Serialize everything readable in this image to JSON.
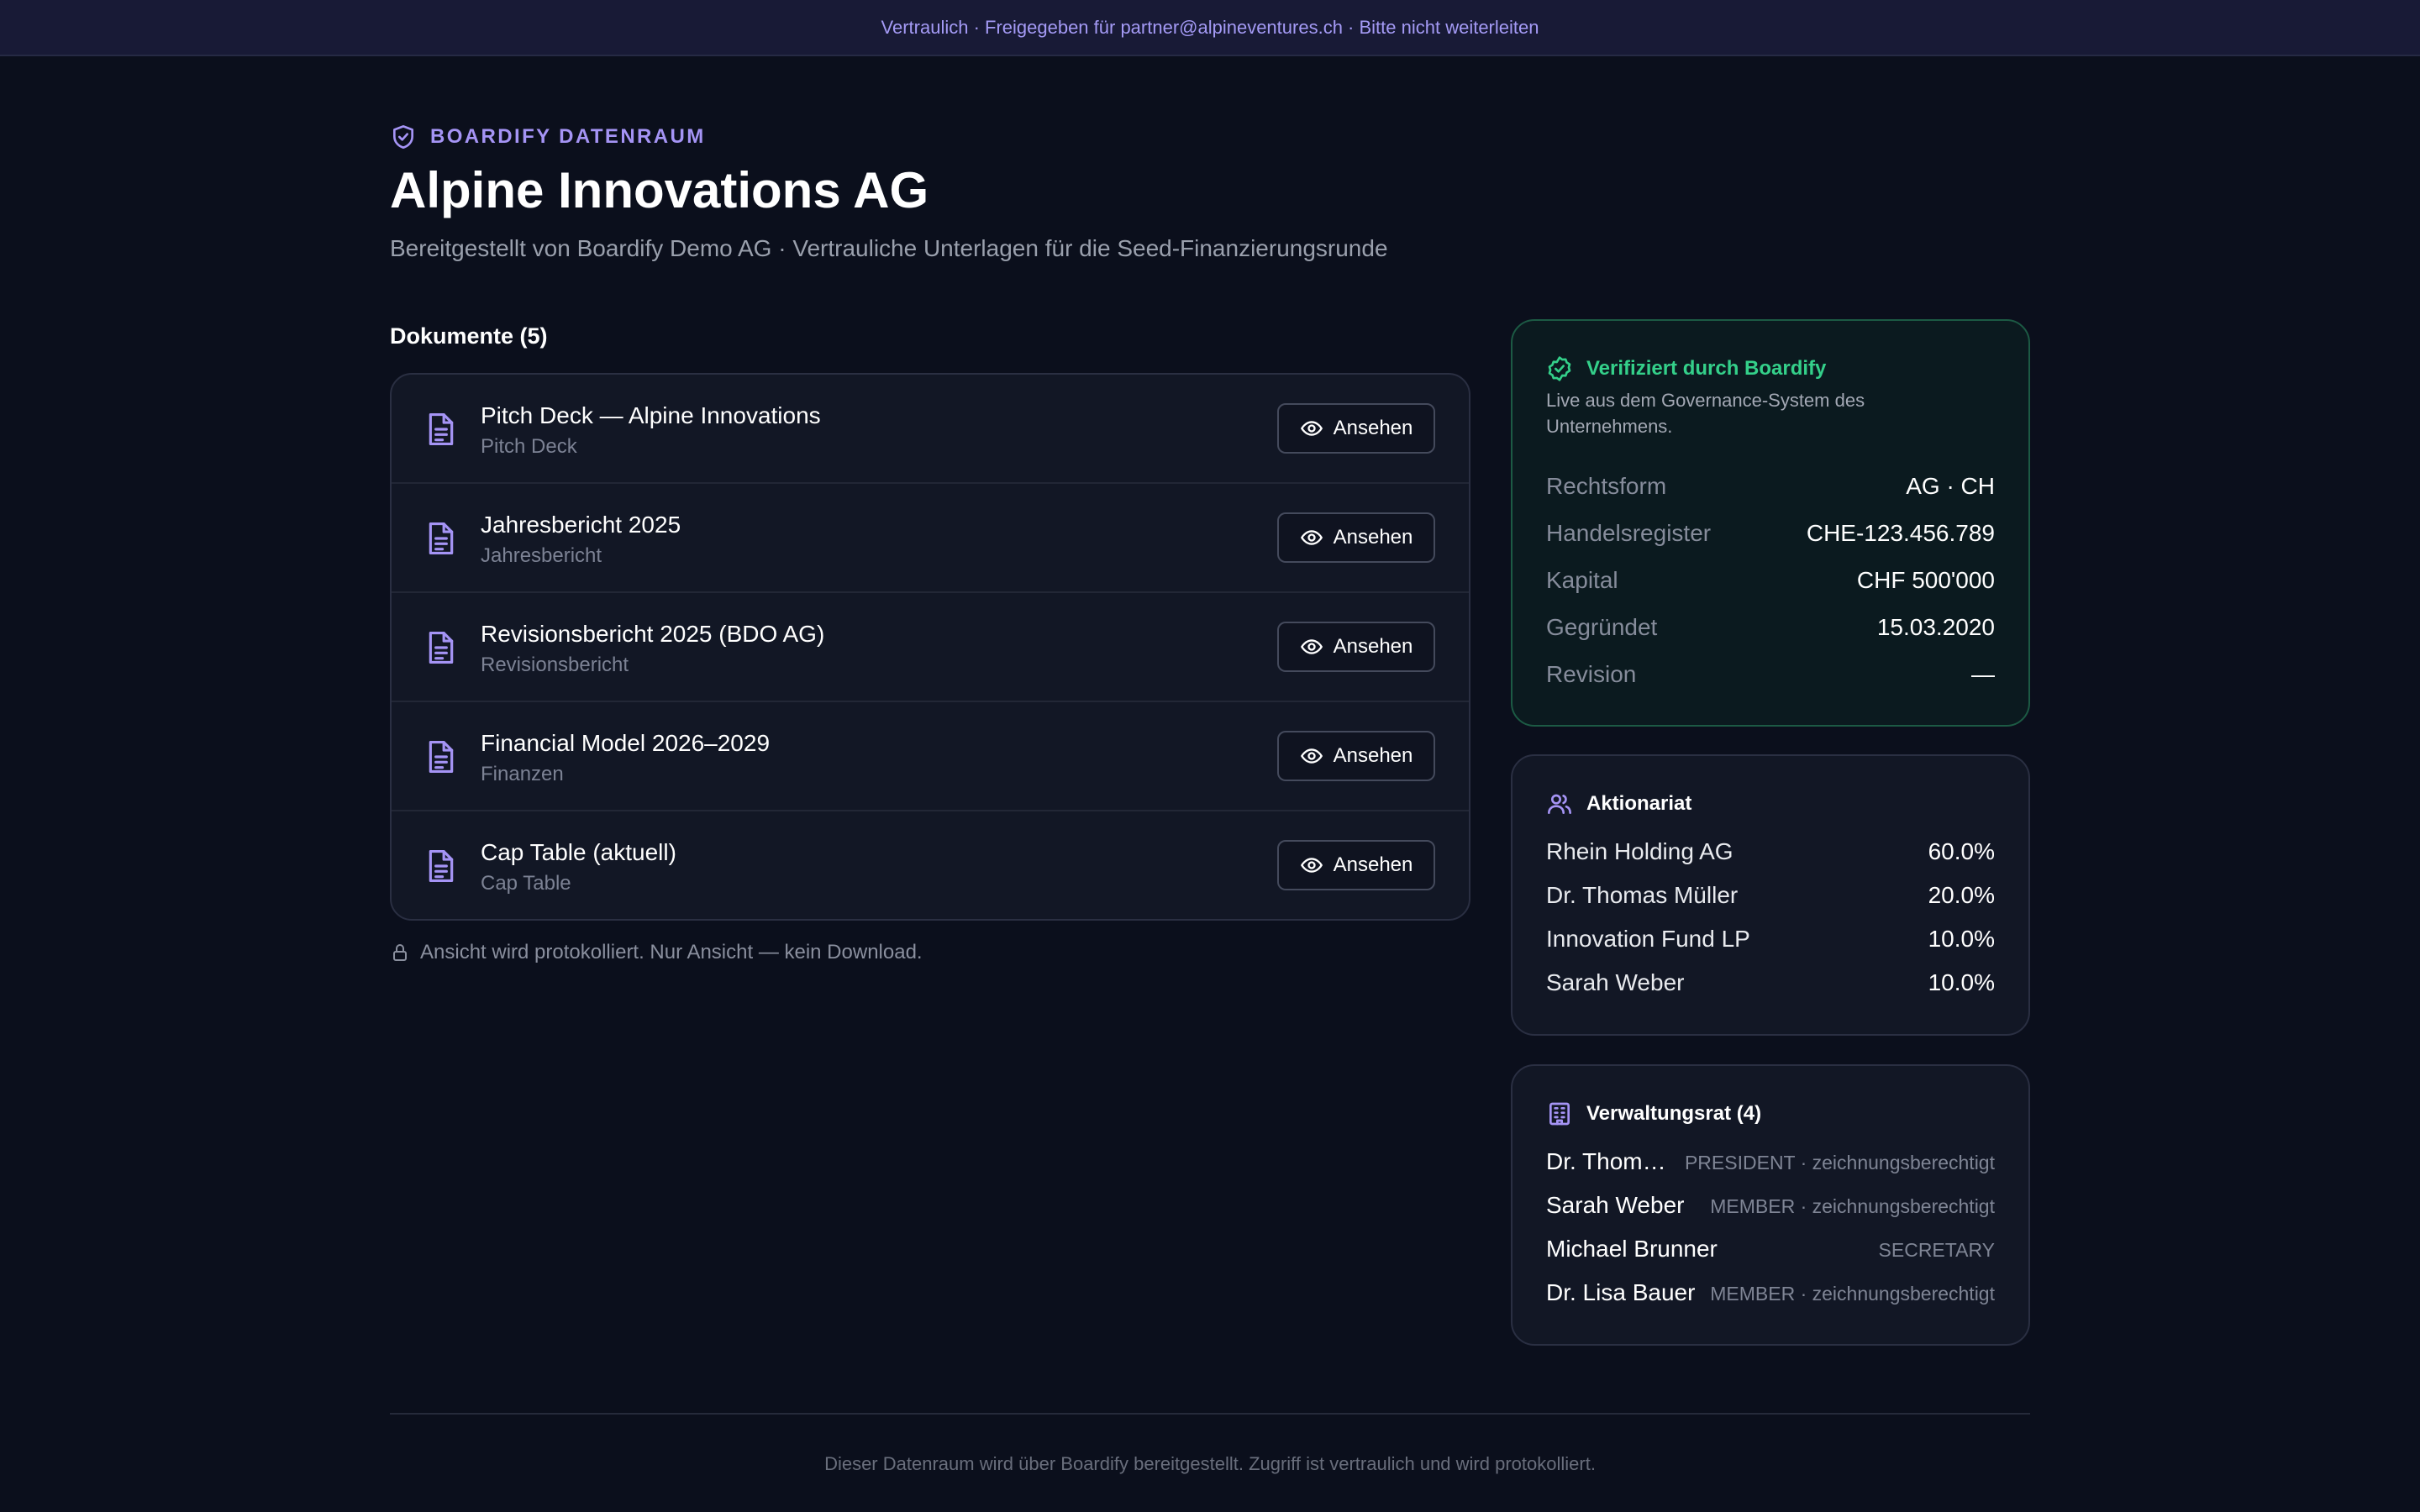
{
  "banner": {
    "text": "Vertraulich · Freigegeben für partner@alpineventures.ch · Bitte nicht weiterleiten"
  },
  "header": {
    "brand_label": "BOARDIFY DATENRAUM",
    "title": "Alpine Innovations AG",
    "subtitle": "Bereitgestellt von Boardify Demo AG · Vertrauliche Unterlagen für die Seed-Finanzierungsrunde"
  },
  "documents": {
    "heading": "Dokumente (5)",
    "view_label": "Ansehen",
    "items": [
      {
        "title": "Pitch Deck — Alpine Innovations",
        "category": "Pitch Deck"
      },
      {
        "title": "Jahresbericht 2025",
        "category": "Jahresbericht"
      },
      {
        "title": "Revisionsbericht 2025 (BDO AG)",
        "category": "Revisionsbericht"
      },
      {
        "title": "Financial Model 2026–2029",
        "category": "Finanzen"
      },
      {
        "title": "Cap Table (aktuell)",
        "category": "Cap Table"
      }
    ],
    "log_note": "Ansicht wird protokolliert. Nur Ansicht — kein Download."
  },
  "verified": {
    "title": "Verifiziert durch Boardify",
    "description": "Live aus dem Governance-System des Unternehmens.",
    "facts": [
      {
        "label": "Rechtsform",
        "value": "AG · CH"
      },
      {
        "label": "Handelsregister",
        "value": "CHE-123.456.789"
      },
      {
        "label": "Kapital",
        "value": "CHF 500'000"
      },
      {
        "label": "Gegründet",
        "value": "15.03.2020"
      },
      {
        "label": "Revision",
        "value": "—"
      }
    ]
  },
  "shareholders": {
    "title": "Aktionariat",
    "items": [
      {
        "name": "Rhein Holding AG",
        "share": "60.0%"
      },
      {
        "name": "Dr. Thomas Müller",
        "share": "20.0%"
      },
      {
        "name": "Innovation Fund LP",
        "share": "10.0%"
      },
      {
        "name": "Sarah Weber",
        "share": "10.0%"
      }
    ]
  },
  "board": {
    "title": "Verwaltungsrat (4)",
    "members": [
      {
        "name": "Dr. Thomas Müller",
        "role": "PRESIDENT · zeichnungsberechtigt"
      },
      {
        "name": "Sarah Weber",
        "role": "MEMBER · zeichnungsberechtigt"
      },
      {
        "name": "Michael Brunner",
        "role": "SECRETARY"
      },
      {
        "name": "Dr. Lisa Bauer",
        "role": "MEMBER · zeichnungsberechtigt"
      }
    ]
  },
  "footer": {
    "text": "Dieser Datenraum wird über Boardify bereitgestellt. Zugriff ist vertraulich und wird protokolliert."
  },
  "colors": {
    "background": "#0b0f1c",
    "accent": "#a594f5",
    "verified_green": "#34d08a",
    "card": "#121725"
  },
  "icons": {
    "brand": "shield-check-icon",
    "document": "document-text-icon",
    "view": "eye-icon",
    "lock": "lock-icon",
    "verified": "badge-check-icon",
    "shareholders": "users-icon",
    "board": "building-icon"
  }
}
